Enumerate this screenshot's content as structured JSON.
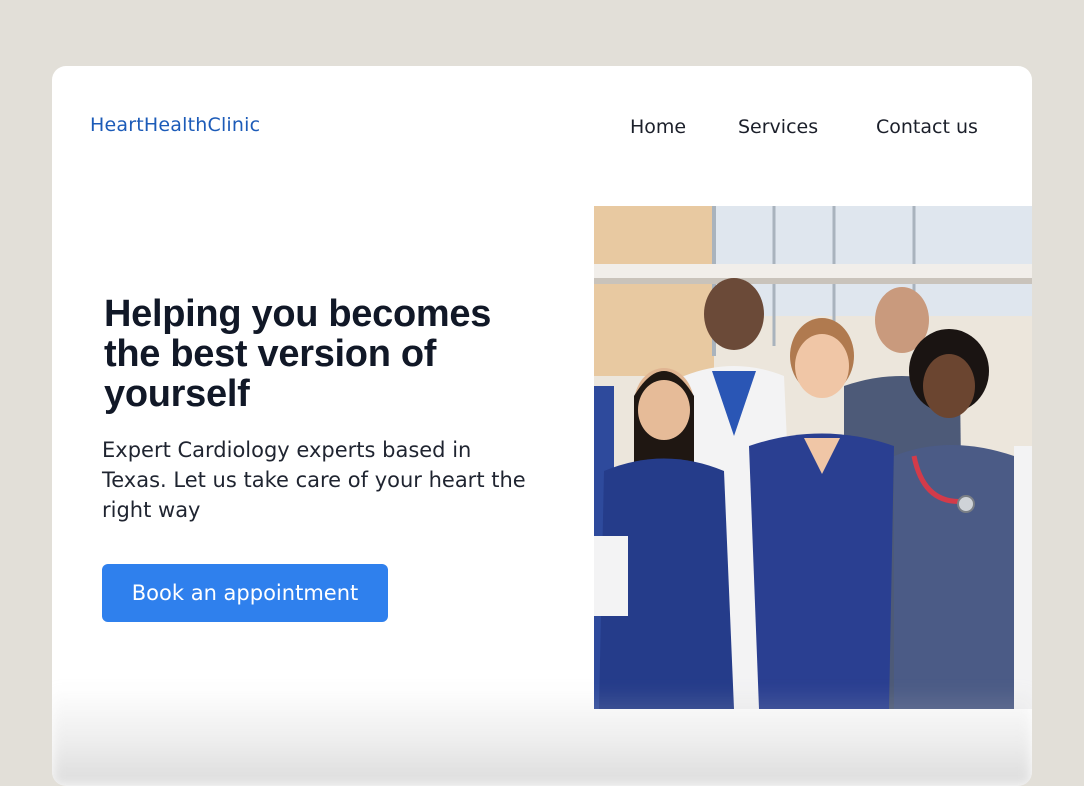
{
  "brand": {
    "name": "HeartHealthClinic",
    "color": "#1c5bb8"
  },
  "nav": {
    "items": [
      {
        "label": "Home"
      },
      {
        "label": "Services"
      },
      {
        "label": "Contact us"
      }
    ]
  },
  "hero": {
    "title": "Helping you becomes the best version of yourself",
    "subtitle": "Expert Cardiology experts based in Texas. Let us take care of your heart the right way",
    "cta_label": "Book an appointment",
    "cta_color": "#2f80ed",
    "image_alt": "medical-team-photo"
  },
  "colors": {
    "background": "#e2dfd8",
    "card": "#ffffff",
    "heading": "#111827",
    "scrub_navy": "#253c8a",
    "scrub_gray": "#4d5a78",
    "coat_white": "#f3f3f4"
  }
}
